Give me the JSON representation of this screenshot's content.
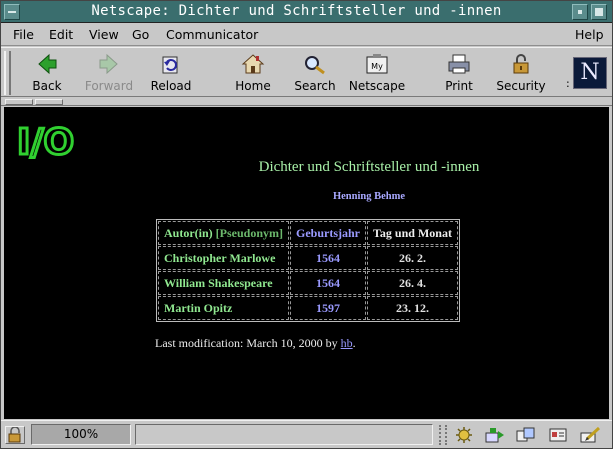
{
  "window": {
    "title": "Netscape: Dichter und Schriftsteller und -innen"
  },
  "menubar": {
    "items": [
      "File",
      "Edit",
      "View",
      "Go",
      "Communicator"
    ],
    "help": "Help"
  },
  "toolbar": {
    "buttons": [
      {
        "label": "Back",
        "icon": "back-arrow-icon",
        "enabled": true
      },
      {
        "label": "Forward",
        "icon": "forward-arrow-icon",
        "enabled": false
      },
      {
        "label": "Reload",
        "icon": "reload-icon",
        "enabled": true
      },
      {
        "label": "Home",
        "icon": "home-icon",
        "enabled": true
      },
      {
        "label": "Search",
        "icon": "search-icon",
        "enabled": true
      },
      {
        "label": "Netscape",
        "icon": "my-netscape-icon",
        "enabled": true
      },
      {
        "label": "Print",
        "icon": "print-icon",
        "enabled": true
      },
      {
        "label": "Security",
        "icon": "security-lock-icon",
        "enabled": true
      }
    ],
    "logo_letter": "N",
    "logo_colon": ":"
  },
  "page": {
    "logo_text": "I/O",
    "title": "Dichter und Schriftsteller und -innen",
    "author": "Henning Behme",
    "table": {
      "headers": {
        "author": "Autor(in)",
        "pseudonym": "[Pseudonym]",
        "year": "Geburtsjahr",
        "date": "Tag und Monat"
      },
      "rows": [
        {
          "name": "Christopher Marlowe",
          "year": "1564",
          "date": "26. 2."
        },
        {
          "name": "William Shakespeare",
          "year": "1564",
          "date": "26. 4."
        },
        {
          "name": "Martin Opitz",
          "year": "1597",
          "date": "23. 12."
        }
      ]
    },
    "modification": {
      "prefix": "Last modification: March 10, 2000 by",
      "link": "hb",
      "suffix": "."
    }
  },
  "statusbar": {
    "zoom": "100%",
    "colors": {
      "accent_titlebar": "#3a6e6e",
      "page_background": "#000000",
      "title_green": "#a8f0a8",
      "author_blue": "#a8a8ff"
    }
  }
}
